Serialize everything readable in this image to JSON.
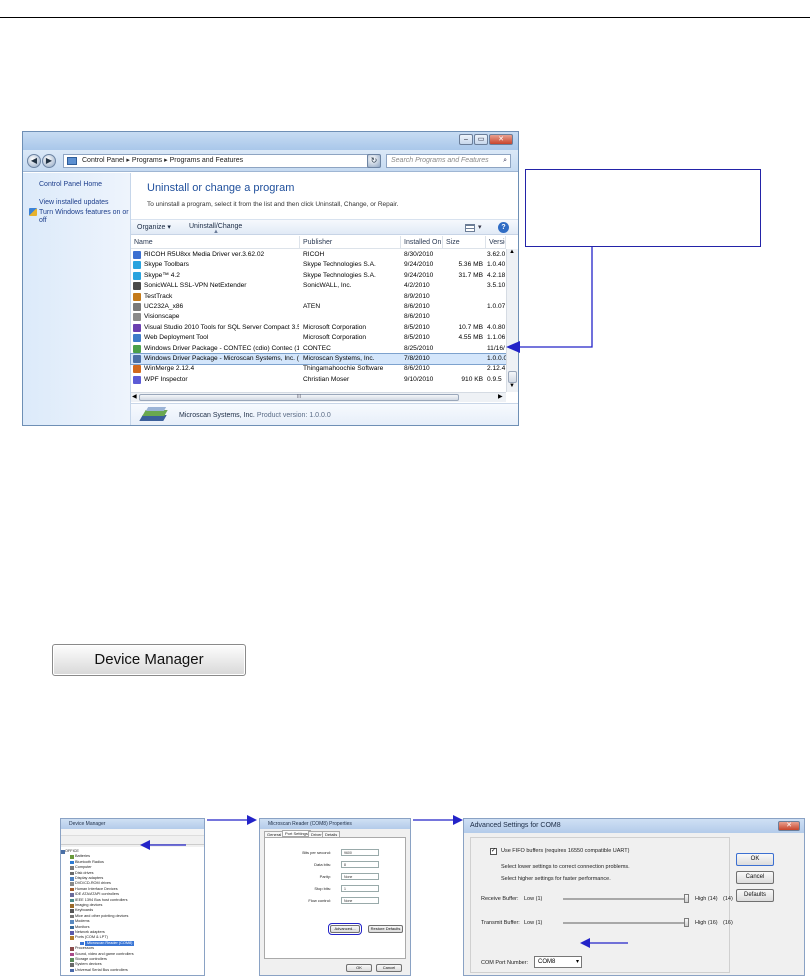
{
  "pf_window": {
    "title_buttons": [
      "–",
      "▭",
      "✕"
    ],
    "address": {
      "path": [
        "Control Panel",
        "Programs",
        "Programs and Features"
      ],
      "search_placeholder": "Search Programs and Features"
    },
    "sidebar": {
      "home": "Control Panel Home",
      "links": [
        "View installed updates",
        "Turn Windows features on or off"
      ]
    },
    "heading": "Uninstall or change a program",
    "subtext": "To uninstall a program, select it from the list and then click Uninstall, Change, or Repair.",
    "toolbar": {
      "organize": "Organize ▾",
      "uninstall": "Uninstall/Change"
    },
    "columns": [
      "Name",
      "Publisher",
      "Installed On",
      "Size",
      "Versio"
    ],
    "rows": [
      {
        "name": "RICOH R5U8xx Media Driver ver.3.62.02",
        "publisher": "RICOH",
        "installed": "8/30/2010",
        "size": "",
        "version": "3.62.0",
        "color": "#3b6fd1"
      },
      {
        "name": "Skype Toolbars",
        "publisher": "Skype Technologies S.A.",
        "installed": "9/24/2010",
        "size": "5.36 MB",
        "version": "1.0.40",
        "color": "#29a3df"
      },
      {
        "name": "Skype™ 4.2",
        "publisher": "Skype Technologies S.A.",
        "installed": "9/24/2010",
        "size": "31.7 MB",
        "version": "4.2.18",
        "color": "#29a3df"
      },
      {
        "name": "SonicWALL SSL-VPN NetExtender",
        "publisher": "SonicWALL, Inc.",
        "installed": "4/2/2010",
        "size": "",
        "version": "3.5.10",
        "color": "#4a4a4a"
      },
      {
        "name": "TestTrack",
        "publisher": "",
        "installed": "8/9/2010",
        "size": "",
        "version": "",
        "color": "#c47a1a"
      },
      {
        "name": "UC232A_x86",
        "publisher": "ATEN",
        "installed": "8/6/2010",
        "size": "",
        "version": "1.0.07",
        "color": "#7a7a7a"
      },
      {
        "name": "Visionscape",
        "publisher": "",
        "installed": "8/6/2010",
        "size": "",
        "version": "",
        "color": "#8b8b8b"
      },
      {
        "name": "Visual Studio 2010 Tools for SQL Server Compact 3.5 ...",
        "publisher": "Microsoft Corporation",
        "installed": "8/5/2010",
        "size": "10.7 MB",
        "version": "4.0.80",
        "color": "#6a3fb0"
      },
      {
        "name": "Web Deployment Tool",
        "publisher": "Microsoft Corporation",
        "installed": "8/5/2010",
        "size": "4.55 MB",
        "version": "1.1.06",
        "color": "#3d7cc9"
      },
      {
        "name": "Windows Driver Package - CONTEC (cdio) Contec (1...",
        "publisher": "CONTEC",
        "installed": "8/25/2010",
        "size": "",
        "version": "11/16/",
        "color": "#4aa04a"
      },
      {
        "name": "Windows Driver Package - Microscan Systems, Inc. (...",
        "publisher": "Microscan Systems, Inc.",
        "installed": "7/8/2010",
        "size": "",
        "version": "1.0.0.0",
        "color": "#4a6fa5",
        "selected": true
      },
      {
        "name": "WinMerge 2.12.4",
        "publisher": "Thingamahoochie Software",
        "installed": "8/6/2010",
        "size": "",
        "version": "2.12.4",
        "color": "#d2691e"
      },
      {
        "name": "WPF Inspector",
        "publisher": "Christian Moser",
        "installed": "9/10/2010",
        "size": "910 KB",
        "version": "0.9.5",
        "color": "#5b5bd6"
      }
    ],
    "hscroll_mark": "III",
    "details": {
      "publisher": "Microscan Systems, Inc.",
      "product_version": "Product version: 1.0.0.0"
    }
  },
  "device_manager_button": "Device Manager",
  "dm_window": {
    "title": "Device Manager",
    "tree": [
      "OFFICE",
      "Batteries",
      "Bluetooth Radios",
      "Computer",
      "Disk drives",
      "Display adapters",
      "DVD/CD-ROM drives",
      "Human Interface Devices",
      "IDE ATA/ATAPI controllers",
      "IEEE 1394 Bus host controllers",
      "Imaging devices",
      "Keyboards",
      "Mice and other pointing devices",
      "Modems",
      "Monitors",
      "Network adapters",
      "Ports (COM & LPT)",
      "Microscan Reader (COM8)",
      "Processors",
      "Sound, video and game controllers",
      "Storage controllers",
      "System devices",
      "Universal Serial Bus controllers"
    ]
  },
  "props_window": {
    "title": "Microscan Reader (COM8) Properties",
    "tabs": [
      "General",
      "Port Settings",
      "Driver",
      "Details"
    ],
    "fields": [
      {
        "label": "Bits per second:",
        "value": "9600"
      },
      {
        "label": "Data bits:",
        "value": "8"
      },
      {
        "label": "Parity:",
        "value": "None"
      },
      {
        "label": "Stop bits:",
        "value": "1"
      },
      {
        "label": "Flow control:",
        "value": "None"
      }
    ],
    "advanced": "Advanced...",
    "restore": "Restore Defaults",
    "ok": "OK",
    "cancel": "Cancel"
  },
  "adv_window": {
    "title": "Advanced Settings for COM8",
    "close": "✕",
    "fifo_label": "Use FIFO buffers (requires 16550 compatible UART)",
    "hint1": "Select lower settings to correct connection problems.",
    "hint2": "Select higher settings for faster performance.",
    "receive_label": "Receive Buffer:",
    "transmit_label": "Transmit Buffer:",
    "low_label": "Low (1)",
    "receive_high": "High (14)",
    "receive_value": "(14)",
    "transmit_high": "High (16)",
    "transmit_value": "(16)",
    "com_label": "COM Port Number:",
    "com_value": "COM8",
    "ok": "OK",
    "cancel": "Cancel",
    "defaults": "Defaults"
  },
  "colors": {
    "arrow": "#2323c8",
    "accent": "#1f4f9c",
    "selection": "#d4e6fb"
  }
}
